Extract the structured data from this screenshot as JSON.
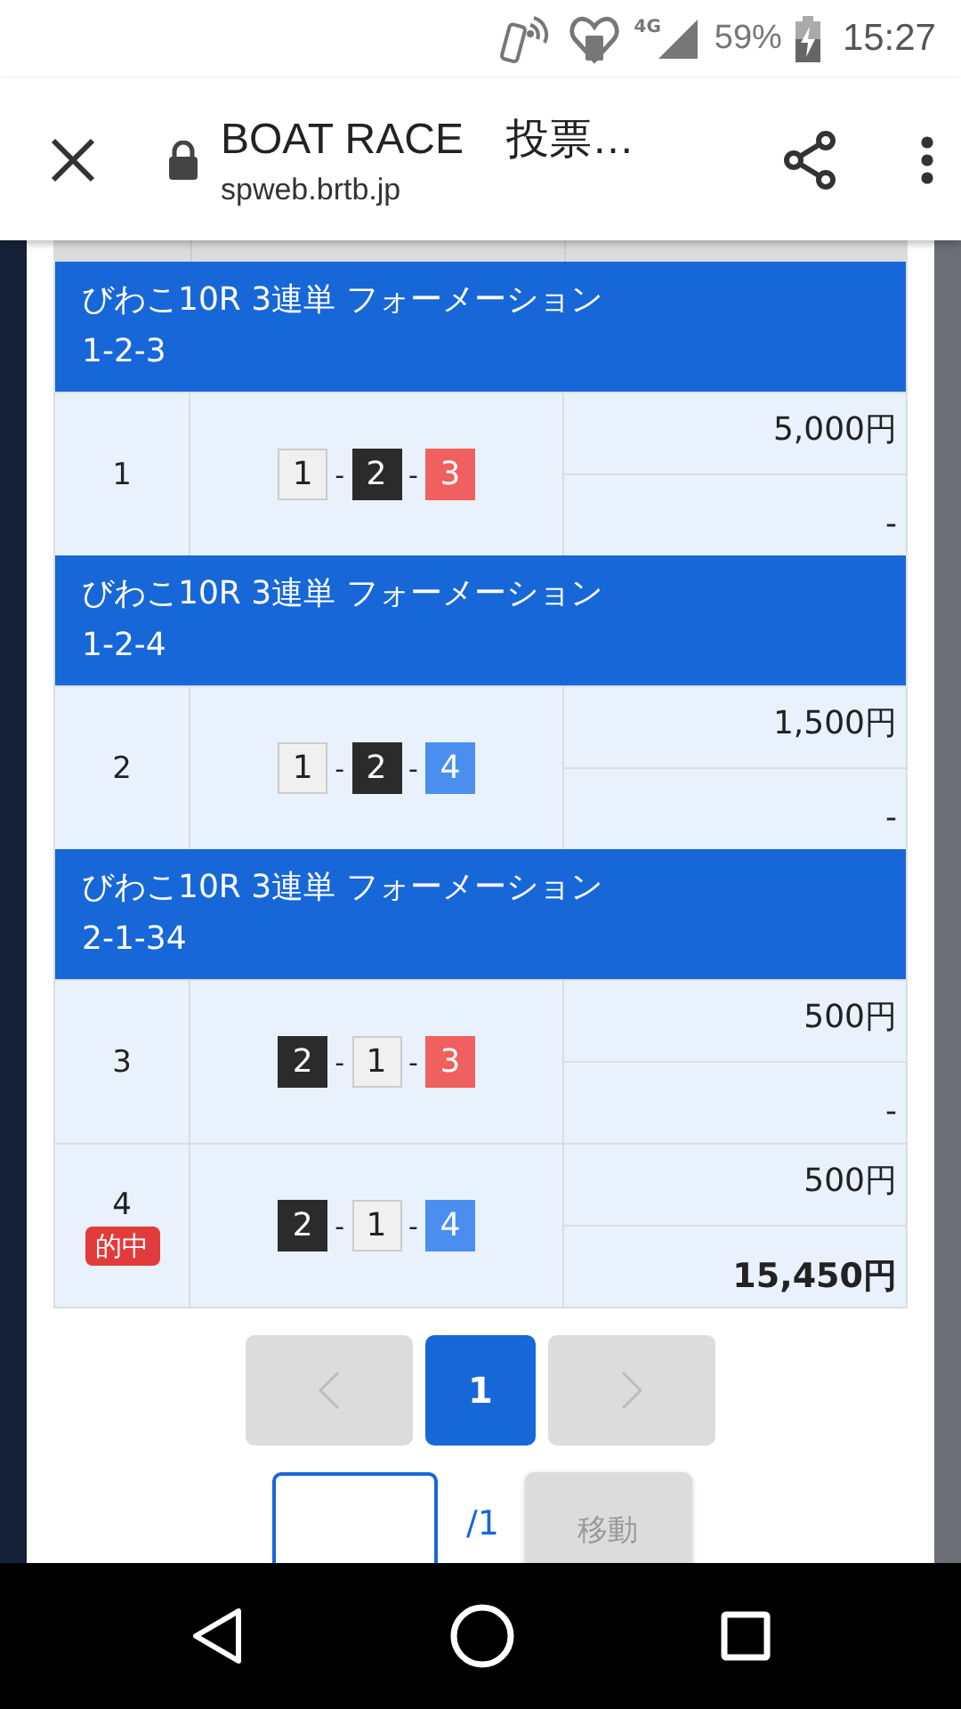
{
  "status_bar": {
    "network": "4G",
    "battery": "59%",
    "time": "15:27"
  },
  "toolbar": {
    "title": "BOAT RACE　投票…",
    "url": "spweb.brtb.jp"
  },
  "groups": [
    {
      "title": "びわこ10R 3連単 フォーメーション",
      "combo": "1-2-3",
      "rows": [
        {
          "no": "1",
          "hit": false,
          "boats": [
            {
              "num": "1",
              "color": "#f0f0f0"
            },
            {
              "sep": "-",
              "num": "2",
              "color": "#2b2b2b"
            },
            {
              "sep": "-",
              "num": "3",
              "color": "#f0605f"
            }
          ],
          "stake": "5,000円",
          "payout": "-"
        }
      ]
    },
    {
      "title": "びわこ10R 3連単 フォーメーション",
      "combo": "1-2-4",
      "rows": [
        {
          "no": "2",
          "hit": false,
          "boats": [
            {
              "num": "1",
              "color": "#f0f0f0"
            },
            {
              "sep": "-",
              "num": "2",
              "color": "#2b2b2b"
            },
            {
              "sep": "-",
              "num": "4",
              "color": "#4a8ff0"
            }
          ],
          "stake": "1,500円",
          "payout": "-"
        }
      ]
    },
    {
      "title": "びわこ10R 3連単 フォーメーション",
      "combo": "2-1-34",
      "rows": [
        {
          "no": "3",
          "hit": false,
          "boats": [
            {
              "num": "2",
              "color": "#2b2b2b"
            },
            {
              "sep": "-",
              "num": "1",
              "color": "#f0f0f0"
            },
            {
              "sep": "-",
              "num": "3",
              "color": "#f0605f"
            }
          ],
          "stake": "500円",
          "payout": "-"
        },
        {
          "no": "4",
          "hit": true,
          "badge": "的中",
          "boats": [
            {
              "num": "2",
              "color": "#2b2b2b"
            },
            {
              "sep": "-",
              "num": "1",
              "color": "#f0f0f0"
            },
            {
              "sep": "-",
              "num": "4",
              "color": "#4a8ff0"
            }
          ],
          "stake": "500円",
          "payout": "15,450円"
        }
      ]
    }
  ],
  "pagination": {
    "pages": [
      {
        "label": "1",
        "selected": true
      }
    ],
    "prev_disabled": true,
    "next_disabled": true
  },
  "jump": {
    "total": "/1",
    "button": "移動"
  }
}
